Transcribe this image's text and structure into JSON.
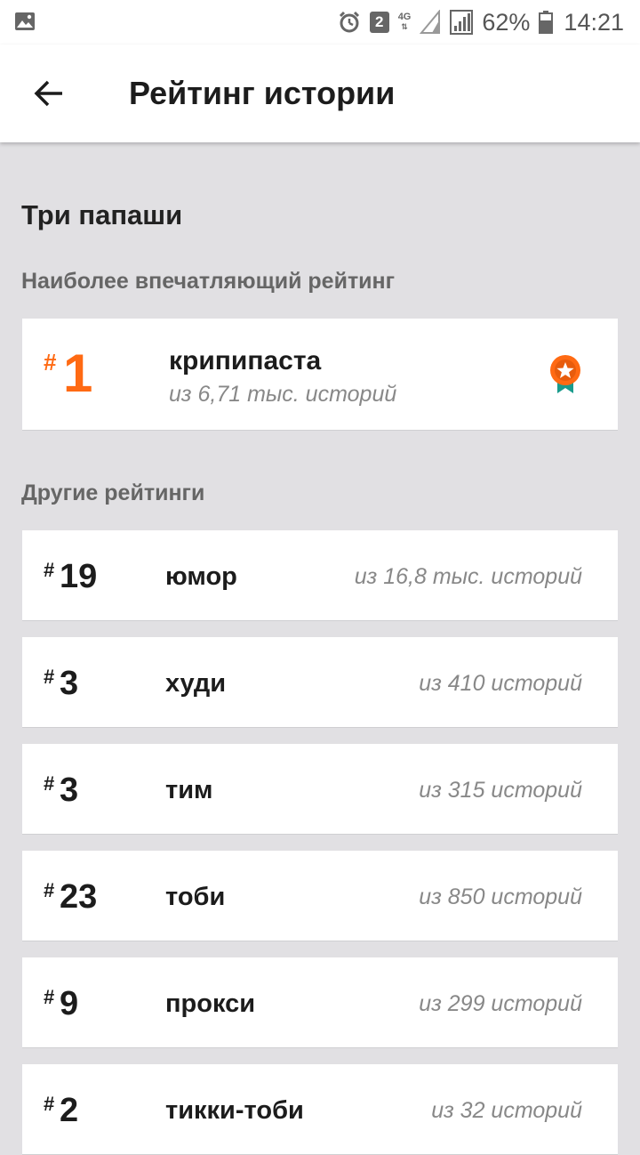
{
  "status_bar": {
    "network": "4G",
    "sim_badge": "2",
    "battery": "62%",
    "time": "14:21"
  },
  "appbar": {
    "title": "Рейтинг истории"
  },
  "story": {
    "title": "Три папаши"
  },
  "top_section": {
    "label": "Наиболее впечатляющий рейтинг",
    "item": {
      "hash": "#",
      "rank": "1",
      "name": "крипипаста",
      "count": "из 6,71 тыс. историй"
    },
    "accent_color": "#ff6a13"
  },
  "other_section": {
    "label": "Другие рейтинги",
    "items": [
      {
        "hash": "#",
        "rank": "19",
        "name": "юмор",
        "count": "из 16,8 тыс. историй"
      },
      {
        "hash": "#",
        "rank": "3",
        "name": "худи",
        "count": "из 410 историй"
      },
      {
        "hash": "#",
        "rank": "3",
        "name": "тим",
        "count": "из 315 историй"
      },
      {
        "hash": "#",
        "rank": "23",
        "name": "тоби",
        "count": "из 850 историй"
      },
      {
        "hash": "#",
        "rank": "9",
        "name": "прокси",
        "count": "из 299 историй"
      },
      {
        "hash": "#",
        "rank": "2",
        "name": "тикки-тоби",
        "count": "из 32 историй"
      }
    ]
  },
  "icons": {
    "back": "arrow-back-icon",
    "badge": "ribbon-award-icon"
  }
}
